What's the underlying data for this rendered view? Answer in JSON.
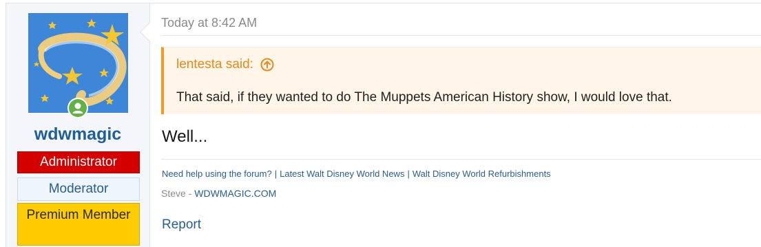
{
  "user": {
    "username": "wdwmagic",
    "badges": {
      "admin": "Administrator",
      "moderator": "Moderator",
      "premium": "Premium Member"
    },
    "online_color": "#63b145",
    "avatar_bg": "#3d86d8"
  },
  "post": {
    "date": "Today at 8:42 AM",
    "quote": {
      "author": "lentesta said:",
      "text": "That said, if they wanted to do The Muppets American History show, I would love that."
    },
    "body": "Well...",
    "signature": {
      "links": [
        "Need help using the forum?",
        "Latest Walt Disney World News",
        "Walt Disney World Refurbishments"
      ],
      "separator": "|",
      "name": "Steve",
      "dash": " - ",
      "site": "WDWMAGIC.COM"
    },
    "report": "Report"
  },
  "colors": {
    "accent": "#2a5d8e",
    "quote_accent": "#f19a25",
    "admin": "#d40000",
    "premium": "#ffcc00"
  }
}
